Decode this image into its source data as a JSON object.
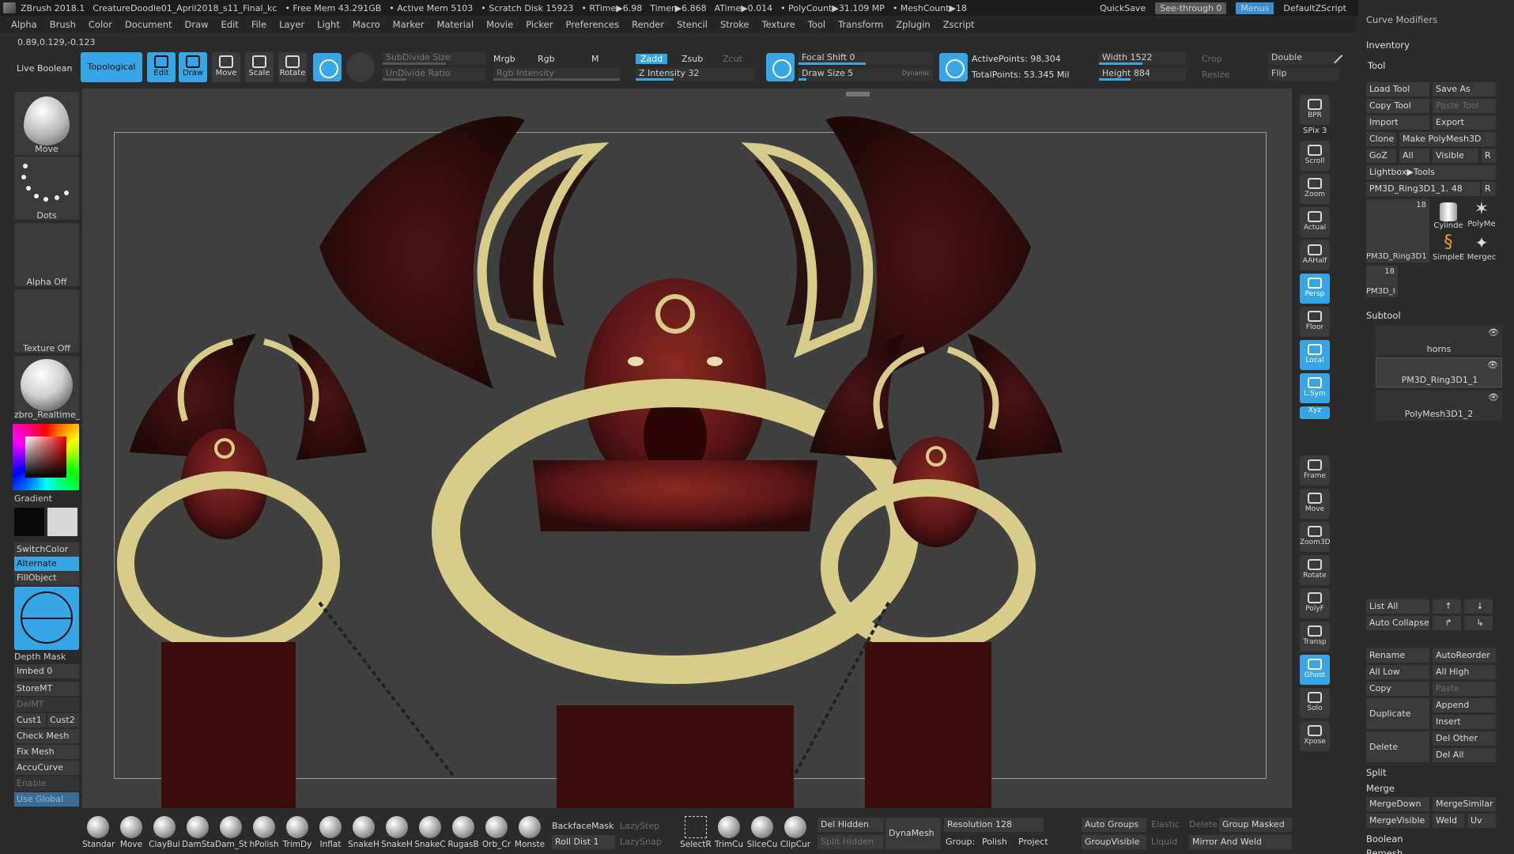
{
  "titlebar": {
    "app": "ZBrush 2018.1",
    "document": "CreatureDoodle01_April2018_s11_Final_kc",
    "free_mem": "• Free Mem 43.291GB",
    "active_mem": "• Active Mem 5103",
    "scratch": "• Scratch Disk 15923",
    "rtime": "• RTime▶6.98",
    "timer": "Timer▶6.868",
    "atime": "ATime▶0.014",
    "polycount": "• PolyCount▶31.109 MP",
    "meshcount": "• MeshCount▶18",
    "quicksave": "QuickSave",
    "seethrough": "See-through  0",
    "menus": "Menus",
    "script": "DefaultZScript"
  },
  "menu": [
    "Alpha",
    "Brush",
    "Color",
    "Document",
    "Draw",
    "Edit",
    "File",
    "Layer",
    "Light",
    "Macro",
    "Marker",
    "Material",
    "Movie",
    "Picker",
    "Preferences",
    "Render",
    "Stencil",
    "Stroke",
    "Texture",
    "Tool",
    "Transform",
    "Zplugin",
    "Zscript"
  ],
  "coords": "0.89,0.129,-0.123",
  "toolbar": {
    "live_boolean": "Live Boolean",
    "topological": "Topological",
    "edit": "Edit",
    "draw": "Draw",
    "move": "Move",
    "scale": "Scale",
    "rotate": "Rotate",
    "subdivide_size": "SubDivide Size",
    "undivide_ratio": "UnDivide Ratio",
    "mrgb": "Mrgb",
    "rgb": "Rgb",
    "m": "M",
    "rgb_intensity": "Rgb Intensity",
    "zadd": "Zadd",
    "zsub": "Zsub",
    "zcut": "Zcut",
    "z_intensity": "Z Intensity 32",
    "focal_shift": "Focal Shift 0",
    "draw_size": "Draw Size 5",
    "dynamic": "Dynamic",
    "active_points": "ActivePoints: 98,304",
    "total_points": "TotalPoints: 53.345 Mil",
    "width": "Width 1522",
    "height": "Height 884",
    "crop": "Crop",
    "resize": "Resize",
    "double": "Double",
    "flip": "Flip"
  },
  "left": {
    "brush_label": "Move",
    "stroke_label": "Dots",
    "alpha_label": "Alpha Off",
    "texture_label": "Texture Off",
    "material_label": "zbro_Realtime_",
    "gradient": "Gradient",
    "switchcolor": "SwitchColor",
    "alternate": "Alternate",
    "fillobject": "FillObject",
    "depth_mask": "Depth Mask",
    "imbed": "Imbed 0",
    "storemt": "StoreMT",
    "delmt": "DelMT",
    "cust1": "Cust1",
    "cust2": "Cust2",
    "check_mesh": "Check Mesh In",
    "fix_mesh": "Fix Mesh",
    "accucurve": "AccuCurve",
    "enable": "Enable",
    "use_global": "Use Global"
  },
  "dock": [
    "BPR",
    "SPix 3",
    "Scroll",
    "Zoom",
    "Actual",
    "AAHalf",
    "Persp",
    "Floor",
    "Local",
    "L.Sym",
    "Xyz",
    "Frame",
    "Move",
    "Zoom3D",
    "Rotate",
    "PolyF",
    "Transp",
    "Ghost",
    "Solo",
    "Xpose"
  ],
  "right": {
    "curve_modifiers": "Curve Modifiers",
    "inventory": "Inventory",
    "tool": "Tool",
    "load_tool": "Load Tool",
    "save_as": "Save As",
    "copy_tool": "Copy Tool",
    "paste_tool": "Paste Tool",
    "import": "Import",
    "export": "Export",
    "clone": "Clone",
    "make_polymesh": "Make PolyMesh3D",
    "goz": "GoZ",
    "all": "All",
    "visible": "Visible",
    "r": "R",
    "lightbox_tools": "Lightbox▶Tools",
    "current_tool": "PM3D_Ring3D1_1. 48",
    "tool_thumb_count": "18",
    "tool_thumb_name": "PM3D_Ring3D1",
    "cylinder": "Cylinde",
    "polymesh": "PolyMe",
    "simple": "SimpleE",
    "merge_thumb": "Mergec",
    "thumb2_count": "18",
    "thumb2_name": "PM3D_I",
    "subtool": "Subtool",
    "subtools": [
      "horns",
      "PM3D_Ring3D1_1",
      "PolyMesh3D1_2"
    ],
    "list_all": "List All",
    "auto_collapse": "Auto Collapse",
    "rename": "Rename",
    "autoreorder": "AutoReorder",
    "all_low": "All Low",
    "all_high": "All High",
    "copy": "Copy",
    "paste": "Paste",
    "duplicate": "Duplicate",
    "append": "Append",
    "insert": "Insert",
    "delete": "Delete",
    "del_other": "Del Other",
    "del_all": "Del All",
    "split": "Split",
    "merge": "Merge",
    "mergedown": "MergeDown",
    "mergesimilar": "MergeSimilar",
    "mergevisible": "MergeVisible",
    "weld": "Weld",
    "uv": "Uv",
    "boolean": "Boolean",
    "remesh": "Remesh"
  },
  "bottom": {
    "brushes": [
      "Standar",
      "Move",
      "ClayBui",
      "DamSta",
      "Dam_St",
      "hPolish",
      "TrimDy",
      "Inflat",
      "SnakeH",
      "SnakeH",
      "SnakeC",
      "RugasB",
      "Orb_Cr",
      "Monste"
    ],
    "backface": "BackfaceMask",
    "lazystep": "LazyStep",
    "roll_dist": "Roll Dist 1",
    "lazysnap": "LazySnap",
    "select_r": "SelectR",
    "trimcu": "TrimCu",
    "slicecu": "SliceCu",
    "clipcur": "ClipCur",
    "del_hidden": "Del Hidden",
    "split_hidden": "Split Hidden",
    "dynamesh": "DynaMesh",
    "resolution": "Resolution 128",
    "group": "Group:",
    "polish": "Polish",
    "project": "Project",
    "auto_groups": "Auto Groups",
    "elastic": "Elastic",
    "delete": "Delete",
    "group_masked": "Group Masked",
    "groupvisible": "GroupVisible",
    "liquid": "Liquid",
    "mirror_weld": "Mirror And Weld"
  },
  "colors": {
    "accent": "#36a6e6",
    "gold": "#d9cc8a",
    "flesh": "#6b1c1c"
  }
}
